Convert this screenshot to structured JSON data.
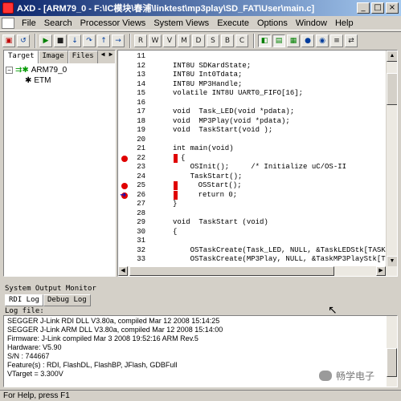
{
  "window": {
    "title": "AXD - [ARM79_0 - F:\\IC模块\\春浦\\linktest\\mp3play\\SD_FAT\\User\\main.c]",
    "minimize": "_",
    "maximize": "□",
    "close": "×",
    "title_color": "#0a246a"
  },
  "menu": [
    "File",
    "Search",
    "Processor Views",
    "System Views",
    "Execute",
    "Options",
    "Window",
    "Help"
  ],
  "left_panel": {
    "tabs": [
      "Target",
      "Image",
      "Files"
    ],
    "tree": {
      "root_expander": "−",
      "root_label": "ARM79_0",
      "child_label": "ETM"
    }
  },
  "code": {
    "lines": [
      {
        "n": "11",
        "text": ""
      },
      {
        "n": "12",
        "text": "INT8U SDKardState;"
      },
      {
        "n": "13",
        "text": "INT8U Int0Tdata;"
      },
      {
        "n": "14",
        "text": "INT8U MP3Handle;"
      },
      {
        "n": "15",
        "text": "volatile INT8U UART0_FIFO[16];"
      },
      {
        "n": "16",
        "text": ""
      },
      {
        "n": "17",
        "text": "void  Task_LED(void *pdata);"
      },
      {
        "n": "18",
        "text": "void  MP3Play(void *pdata);"
      },
      {
        "n": "19",
        "text": "void  TaskStart(void );"
      },
      {
        "n": "20",
        "text": ""
      },
      {
        "n": "21",
        "text": "int main(void)"
      },
      {
        "n": "22",
        "text": "{"
      },
      {
        "n": "23",
        "text": "    OSInit();     /* Initialize uC/OS-II"
      },
      {
        "n": "24",
        "text": "    TaskStart();"
      },
      {
        "n": "25",
        "text": "    OSStart();"
      },
      {
        "n": "26",
        "text": "    return 0;"
      },
      {
        "n": "27",
        "text": "}"
      },
      {
        "n": "28",
        "text": ""
      },
      {
        "n": "29",
        "text": "void  TaskStart (void)"
      },
      {
        "n": "30",
        "text": "{"
      },
      {
        "n": "31",
        "text": ""
      },
      {
        "n": "32",
        "text": "    OSTaskCreate(Task_LED, NULL, &TaskLEDStk[TASK"
      },
      {
        "n": "33",
        "text": "    OSTaskCreate(MP3Play, NULL, &TaskMP3PlayStk[T"
      }
    ],
    "breakpoint_lines": [
      "22",
      "25",
      "26"
    ],
    "current_line": "26"
  },
  "output": {
    "title": "System Output Monitor",
    "tabs": [
      "RDI Log",
      "Debug Log"
    ],
    "log_file_label": "Log file:",
    "log_lines": [
      "SEGGER J-Link RDI DLL V3.80a, compiled Mar 12 2008 15:14:25",
      "SEGGER J-Link ARM DLL V3.80a, compiled Mar 12 2008 15:14:00",
      "Firmware: J-Link compiled Mar  3 2008 19:52:16 ARM Rev.5",
      "Hardware: V5.90",
      "S/N : 744667",
      "Feature(s) : RDI, FlashDL, FlashBP, JFlash, GDBFull",
      "VTarget = 3.300V"
    ]
  },
  "watermark": "畅学电子",
  "status": "For Help, press F1"
}
